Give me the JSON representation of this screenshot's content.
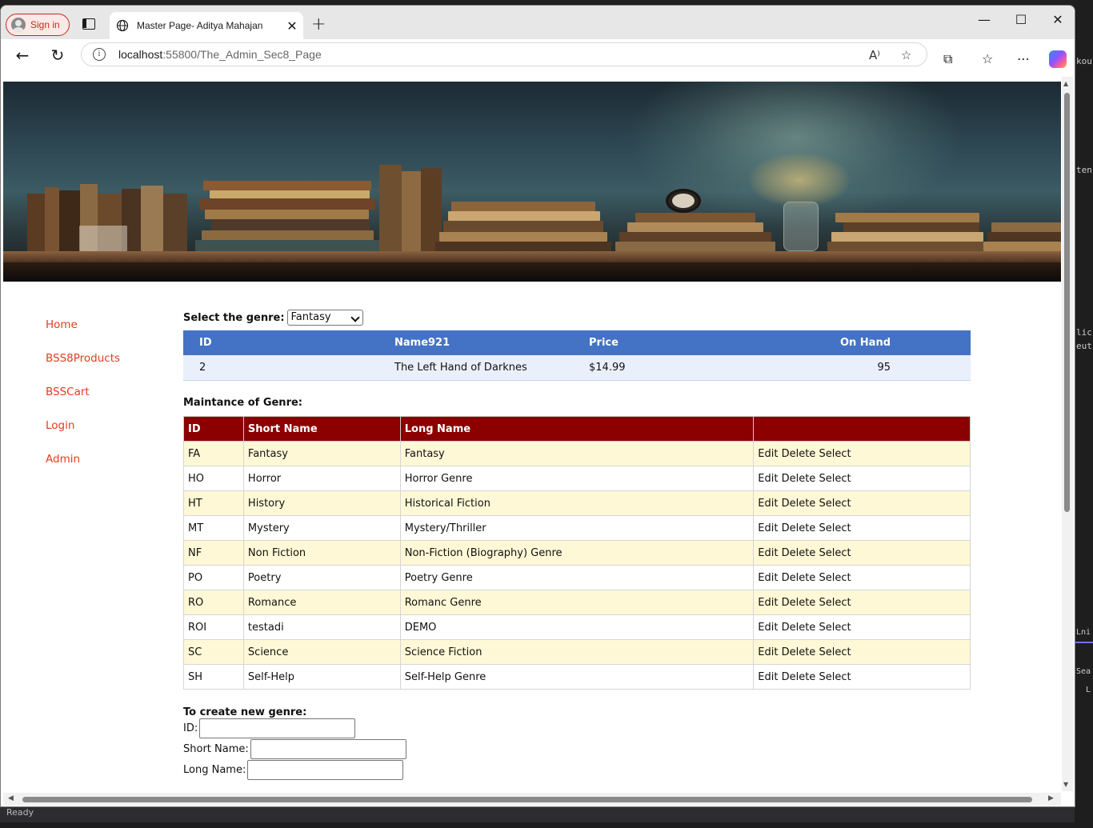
{
  "browser": {
    "signin_label": "Sign in",
    "tab_title": "Master Page- Aditya Mahajan",
    "url_host": "localhost",
    "url_path": ":55800/The_Admin_Sec8_Page"
  },
  "nav": {
    "items": [
      "Home",
      "BSS8Products",
      "BSSCart",
      "Login",
      "Admin"
    ]
  },
  "genre_select": {
    "label": "Select the genre:",
    "selected": "Fantasy"
  },
  "products": {
    "headers": [
      "ID",
      "Name921",
      "Price",
      "On Hand"
    ],
    "rows": [
      {
        "id": "2",
        "name": "The Left Hand of Darknes",
        "price": "$14.99",
        "onhand": "95"
      }
    ]
  },
  "maintenance": {
    "title": "Maintance of Genre:",
    "headers": [
      "ID",
      "Short Name",
      "Long Name",
      ""
    ],
    "actions": {
      "edit": "Edit",
      "delete": "Delete",
      "select": "Select"
    },
    "rows": [
      {
        "id": "FA",
        "short": "Fantasy",
        "long": "Fantasy"
      },
      {
        "id": "HO",
        "short": "Horror",
        "long": "Horror Genre"
      },
      {
        "id": "HT",
        "short": "History",
        "long": "Historical Fiction"
      },
      {
        "id": "MT",
        "short": "Mystery",
        "long": "Mystery/Thriller"
      },
      {
        "id": "NF",
        "short": "Non Fiction",
        "long": "Non-Fiction (Biography) Genre"
      },
      {
        "id": "PO",
        "short": "Poetry",
        "long": "Poetry Genre"
      },
      {
        "id": "RO",
        "short": "Romance",
        "long": "Romanc Genre"
      },
      {
        "id": "ROI",
        "short": "testadi",
        "long": "DEMO"
      },
      {
        "id": "SC",
        "short": "Science",
        "long": "Science Fiction"
      },
      {
        "id": "SH",
        "short": "Self-Help",
        "long": "Self-Help Genre"
      }
    ]
  },
  "create": {
    "title": "To create new genre:",
    "id_label": "ID:",
    "short_label": "Short Name:",
    "long_label": "Long Name:"
  },
  "statusbar": {
    "text": "Ready"
  },
  "background_text": [
    "kou",
    "ten",
    "lic",
    "eut",
    "Lni",
    "Sea",
    "L"
  ]
}
